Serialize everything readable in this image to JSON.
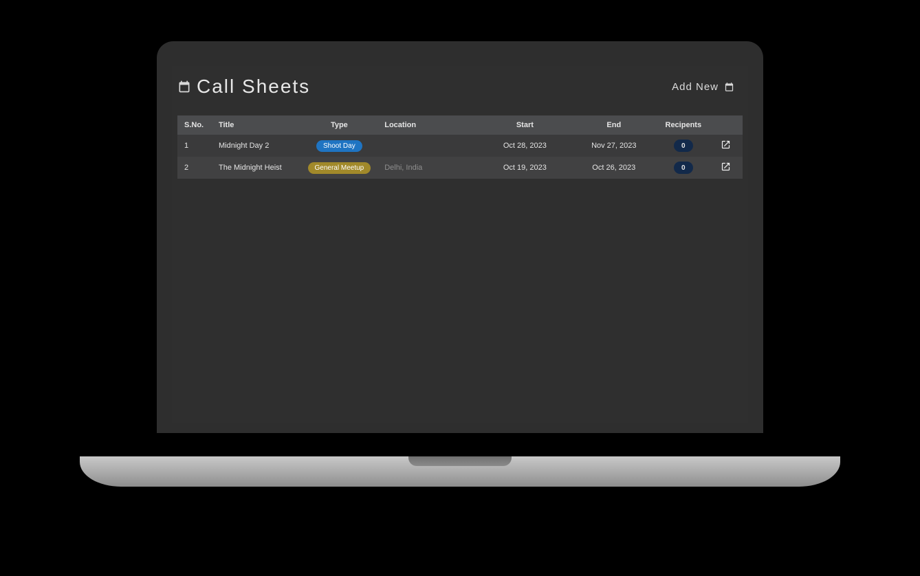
{
  "header": {
    "title": "Call Sheets",
    "add_new_label": "Add New"
  },
  "table": {
    "columns": {
      "sno": "S.No.",
      "title": "Title",
      "type": "Type",
      "location": "Location",
      "start": "Start",
      "end": "End",
      "recipients": "Recipents"
    },
    "rows": [
      {
        "sno": "1",
        "title": "Midnight Day 2",
        "type_label": "Shoot Day",
        "type_color": "blue",
        "location": "",
        "start": "Oct 28, 2023",
        "end": "Nov 27, 2023",
        "recipients": "0"
      },
      {
        "sno": "2",
        "title": "The Midnight Heist",
        "type_label": "General Meetup",
        "type_color": "olive",
        "location": "Delhi, India",
        "start": "Oct 19, 2023",
        "end": "Oct 26, 2023",
        "recipients": "0"
      }
    ]
  }
}
